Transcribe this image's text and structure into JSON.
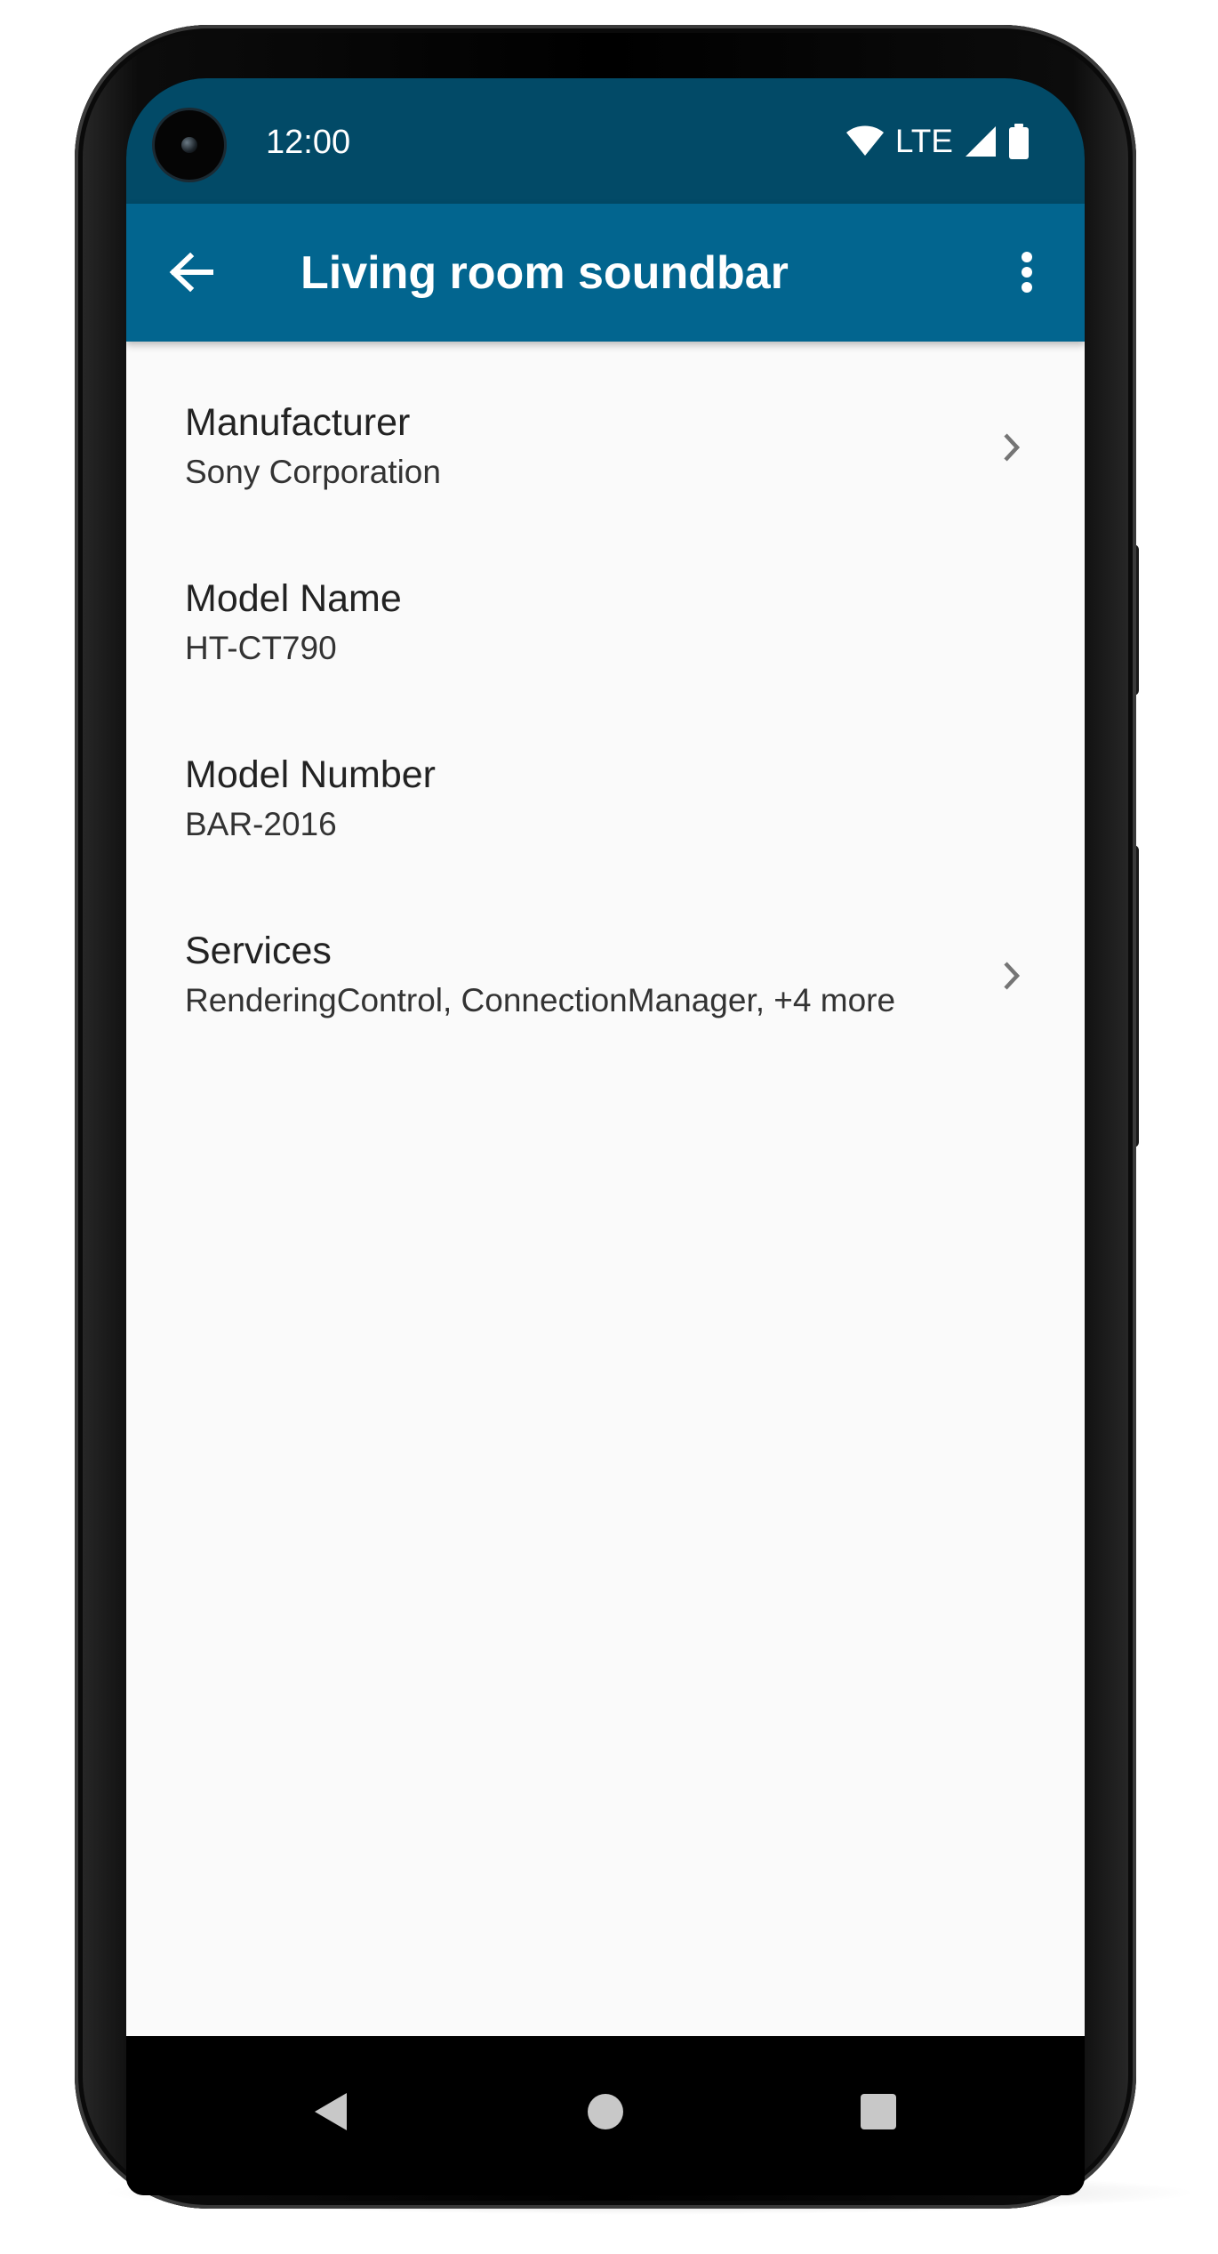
{
  "status_bar": {
    "time": "12:00",
    "network": "LTE",
    "icons": [
      "wifi-icon",
      "signal-icon",
      "battery-icon"
    ]
  },
  "app_bar": {
    "title": "Living room soundbar",
    "back_icon": "arrow-back-icon",
    "menu_icon": "more-vert-icon",
    "color": "#02658F",
    "status_color": "#024A67"
  },
  "details": {
    "items": [
      {
        "title": "Manufacturer",
        "value": "Sony Corporation",
        "has_chevron": true
      },
      {
        "title": "Model Name",
        "value": "HT-CT790",
        "has_chevron": false
      },
      {
        "title": "Model Number",
        "value": "BAR-2016",
        "has_chevron": false
      },
      {
        "title": "Services",
        "value": "RenderingControl, ConnectionManager, +4 more",
        "has_chevron": true
      }
    ]
  },
  "nav_bar": {
    "buttons": [
      "back-triangle-icon",
      "home-circle-icon",
      "recents-square-icon"
    ]
  }
}
